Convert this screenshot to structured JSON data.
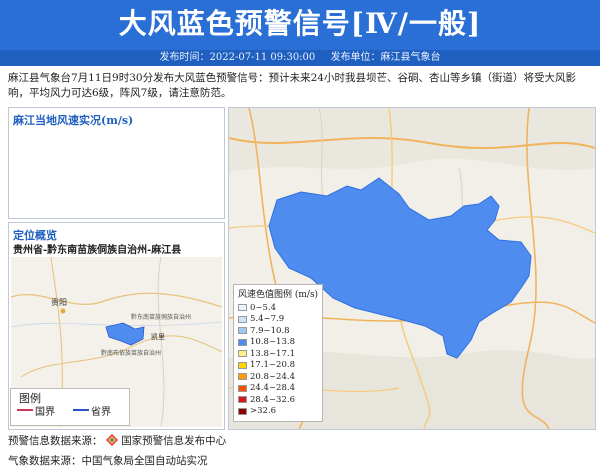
{
  "header": {
    "title": "大风蓝色预警信号[Ⅳ/一般]",
    "publish_time_label": "发布时间：2022-07-11 09:30:00",
    "publish_unit_label": "发布单位：麻江县气象台"
  },
  "description": "麻江县气象台7月11日9时30分发布大风蓝色预警信号：预计未来24小时我县坝芒、谷硐、杏山等乡镇（街道）将受大风影响，平均风力可达6级，阵风7级，请注意防范。",
  "wind_panel": {
    "title": "麻江当地风速实况(m/s)"
  },
  "location_panel": {
    "title": "定位概览",
    "subtitle": "贵州省-黔东南苗族侗族自治州-麻江县",
    "map_labels": [
      "贵阳",
      "黔东南苗族侗族自治州",
      "黔南布依族苗族自治州",
      "凯里"
    ],
    "legend_title": "图例",
    "legend_items": [
      {
        "label": "国界",
        "color": "#c9395a"
      },
      {
        "label": "省界",
        "color": "#2b54c8"
      }
    ]
  },
  "wind_legend": {
    "title": "风速色值图例 (m/s)",
    "items": [
      {
        "label": "0~5.4",
        "color": "#eef4fb"
      },
      {
        "label": "5.4~7.9",
        "color": "#cfe3f6"
      },
      {
        "label": "7.9~10.8",
        "color": "#9cc9ef"
      },
      {
        "label": "10.8~13.8",
        "color": "#4f8cf0"
      },
      {
        "label": "13.8~17.1",
        "color": "#ffef8a"
      },
      {
        "label": "17.1~20.8",
        "color": "#ffd400"
      },
      {
        "label": "20.8~24.4",
        "color": "#ff9a00"
      },
      {
        "label": "24.4~28.4",
        "color": "#ff4e00"
      },
      {
        "label": "28.4~32.6",
        "color": "#d7191c"
      },
      {
        "label": ">32.6",
        "color": "#8b0000"
      }
    ]
  },
  "footer": {
    "source1_label": "预警信息数据来源：",
    "source1_value": "国家预警信息发布中心",
    "source2": "气象数据来源：中国气象局全国自动站实况"
  },
  "colors": {
    "header": "#2a6fd6",
    "warning_area": "#4f8cf0"
  }
}
